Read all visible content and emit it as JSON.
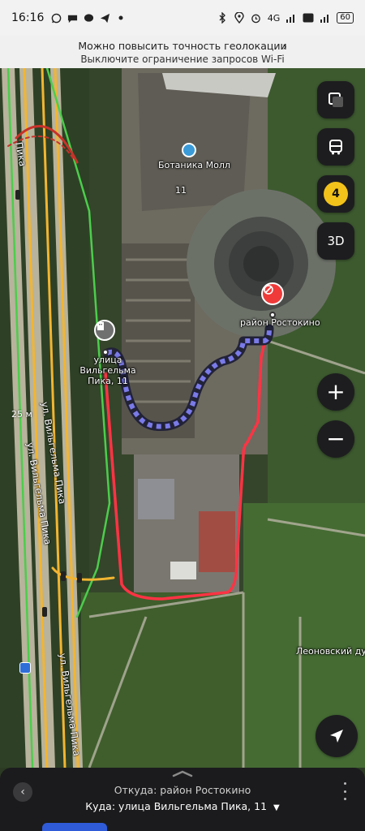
{
  "status_bar": {
    "time": "16:16",
    "network": "4G",
    "battery": "60"
  },
  "geo_banner": {
    "title": "Можно повысить точность геолокации",
    "subtitle": "Выключите ограничение запросов Wi-Fi"
  },
  "map": {
    "poi_mall": "Ботаника Молл",
    "poi_mall_number": "11",
    "place_start": "район Ростокино",
    "place_end": "улица Вильгельма Пика, 11",
    "street_left_1": "ул. Вильгельма Пика",
    "street_left_2": "ул. Вильгельма Пика",
    "street_left_3": "ул. Вильгельма Пика",
    "street_top": "Пика",
    "area_label": "Леоновский дуб",
    "scale": "25 м",
    "icons": [
      "layers-icon",
      "transit-bus-icon",
      "traffic-level-icon",
      "location-arrow-icon"
    ]
  },
  "controls": {
    "traffic_level": "4",
    "three_d": "3D",
    "zoom_in": "+",
    "zoom_out": "−"
  },
  "route_panel": {
    "from_label": "Откуда:",
    "from_value": "район Ростокино",
    "to_label": "Куда:",
    "to_value": "улица Вильгельма Пика, 11"
  },
  "colors": {
    "walk_route": "#5a5ad8",
    "drawn_route": "#ff3344",
    "traffic_green": "#4ccd4c",
    "traffic_yellow": "#f2b531",
    "traffic_red": "#c8322a"
  }
}
